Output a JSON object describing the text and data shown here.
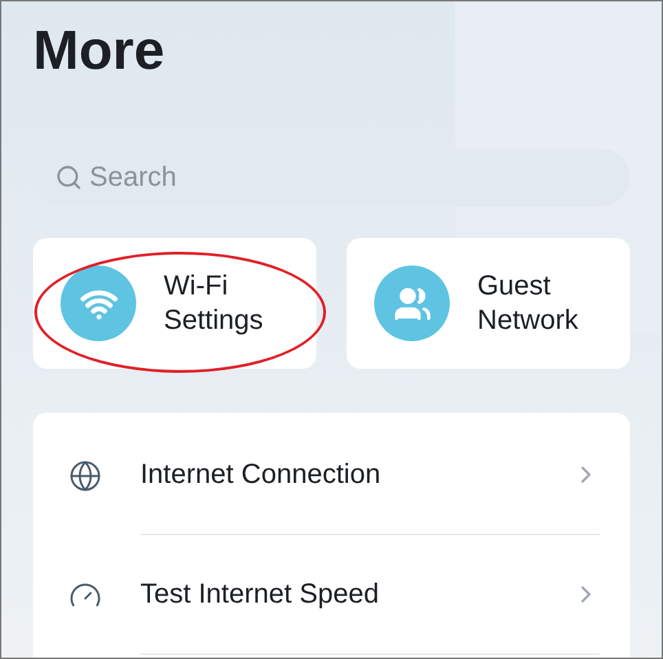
{
  "title": "More",
  "search": {
    "placeholder": "Search"
  },
  "shortcuts": [
    {
      "kind": "wifi",
      "label": "Wi-Fi\nSettings",
      "highlighted": true
    },
    {
      "kind": "users",
      "label": "Guest\nNetwork",
      "highlighted": false
    }
  ],
  "menu": [
    {
      "kind": "globe",
      "label": "Internet Connection"
    },
    {
      "kind": "gauge",
      "label": "Test Internet Speed"
    }
  ]
}
